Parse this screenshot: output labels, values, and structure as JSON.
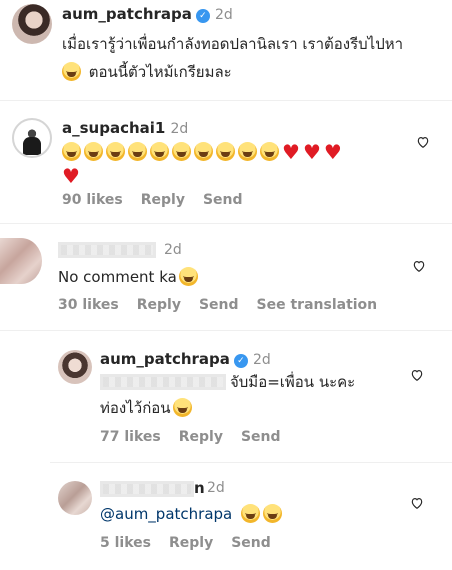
{
  "post": {
    "username": "aum_patchrapa",
    "time": "2d",
    "caption_line1": "เมื่อเรารู้ว่าเพื่อนกำลังทอดปลานิลเรา เราต้องรีบไปหา",
    "caption_line2": "ตอนนี้ตัวไหม้เกรียมละ"
  },
  "comments": [
    {
      "username": "a_supachai1",
      "time": "2d",
      "emoji_line": "😂😂😂😂😂😂😂😂😂😂❤️❤️❤️",
      "emoji_line2": "❤️",
      "likes": "90 likes",
      "reply": "Reply",
      "send": "Send"
    },
    {
      "username": "",
      "time": "2d",
      "text": "No comment ka",
      "likes": "30 likes",
      "reply": "Reply",
      "send": "Send",
      "see_translation": "See translation"
    }
  ],
  "replies": [
    {
      "username": "aum_patchrapa",
      "time": "2d",
      "text_line1": "จับมือ=เพื่อน นะคะ",
      "text_line2": "ท่องไว้ก่อน",
      "likes": "77 likes",
      "reply": "Reply",
      "send": "Send"
    },
    {
      "username_suffix": "n",
      "time": "2d",
      "mention": "@aum_patchrapa",
      "likes": "5 likes",
      "reply": "Reply",
      "send": "Send"
    }
  ]
}
